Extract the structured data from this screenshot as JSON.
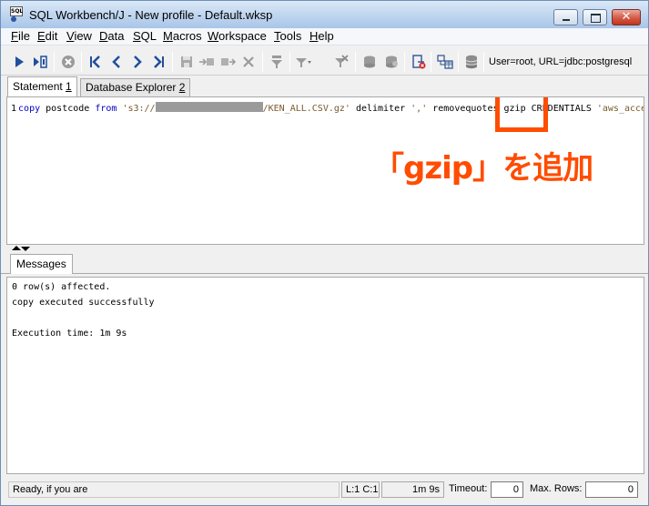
{
  "window": {
    "title": "SQL Workbench/J - New profile - Default.wksp",
    "icon_text": "SQL"
  },
  "menu": {
    "items": [
      {
        "accel": "F",
        "rest": "ile"
      },
      {
        "accel": "E",
        "rest": "dit"
      },
      {
        "accel": "V",
        "rest": "iew"
      },
      {
        "accel": "D",
        "rest": "ata"
      },
      {
        "accel": "S",
        "rest": "QL"
      },
      {
        "accel": "M",
        "rest": "acros"
      },
      {
        "accel": "W",
        "rest": "orkspace"
      },
      {
        "accel": "T",
        "rest": "ools"
      },
      {
        "accel": "H",
        "rest": "elp"
      }
    ]
  },
  "toolbar": {
    "connection_info": "User=root, URL=jdbc:postgresql"
  },
  "tabs": [
    {
      "label": "Statement ",
      "accel": "1"
    },
    {
      "label": "Database Explorer ",
      "accel": "2"
    }
  ],
  "editor": {
    "line_number": "1",
    "sql_keyword1": "copy",
    "sql_text1": " postcode ",
    "sql_keyword2": "from",
    "sql_str1_start": " 's3://",
    "sql_str1_end": "/KEN_ALL.CSV.gz'",
    "sql_text2": " delimiter ",
    "sql_str2": "','",
    "sql_text3": " removequotes gzip CREDENTIALS ",
    "sql_str3": "'aws_acce"
  },
  "annotation": {
    "text": "「gzip」を追加",
    "color": "#ff4c00"
  },
  "messages": {
    "tab_label": "Messages",
    "lines": [
      "0 row(s) affected.",
      "copy executed successfully",
      "",
      "Execution time: 1m 9s"
    ]
  },
  "status": {
    "text": "Ready, if you are",
    "cursor": "L:1 C:1",
    "exec_time": "1m 9s",
    "timeout_label": "Timeout:",
    "timeout_value": "0",
    "maxrows_label": "Max. Rows:",
    "maxrows_value": "0"
  }
}
